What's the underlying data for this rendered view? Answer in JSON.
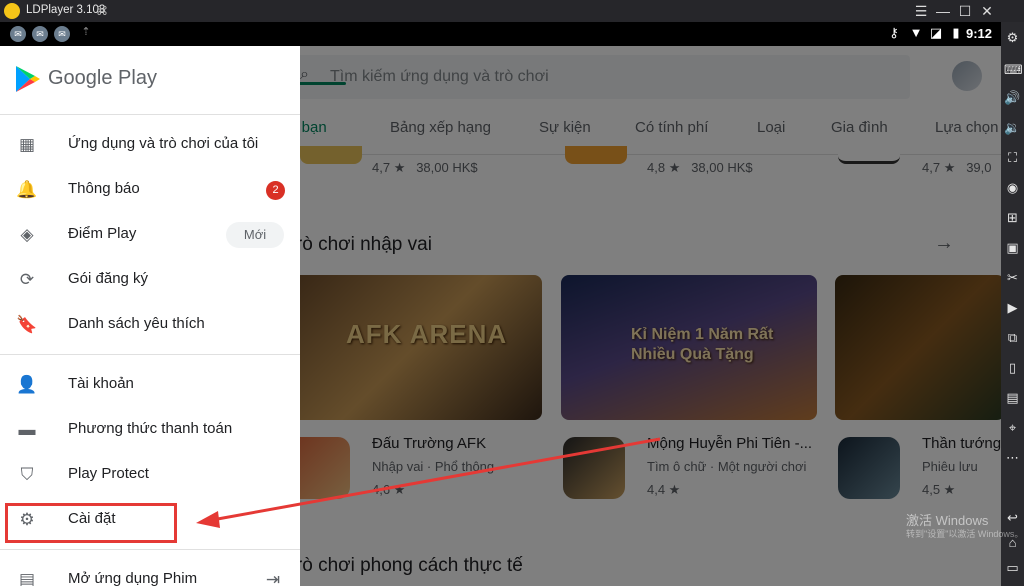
{
  "emulator": {
    "title": "LDPlayer 3.103",
    "controls": {
      "menu": "☰",
      "minimize": "—",
      "restore": "☐",
      "close": "✕"
    }
  },
  "statusbar": {
    "time": "9:12",
    "icons": [
      "key-icon",
      "wifi-icon",
      "no-sim-icon",
      "battery-icon"
    ]
  },
  "store": {
    "search_placeholder": "Tìm kiếm ứng dụng và trò chơi",
    "tabs": [
      "Cho bạn",
      "Bảng xếp hạng",
      "Sự kiện",
      "Có tính phí",
      "Loại",
      "Gia đình",
      "Lựa chọn"
    ],
    "top_row": [
      {
        "rating": "4,7",
        "price": "38,00 HK$"
      },
      {
        "rating": "4,8",
        "price": "38,00 HK$"
      },
      {
        "rating": "4,7",
        "price": "39,0"
      }
    ],
    "section1": "Trò chơi nhập vai",
    "section2": "Trò chơi phong cách thực tế",
    "banners": [
      {
        "text": "AFK ARENA"
      },
      {
        "text": "Kỉ Niệm 1 Năm Rất Nhiều Quà Tặng"
      },
      {
        "text": ""
      }
    ],
    "apps": [
      {
        "name": "Đấu Trường AFK",
        "category": "Nhập vai · Phổ thông",
        "rating": "4,6 ★"
      },
      {
        "name": "Mộng Huyễn Phi Tiên -...",
        "category": "Tìm ô chữ · Một người chơi",
        "rating": "4,4 ★"
      },
      {
        "name": "Thần tướng",
        "category": "Phiêu lưu",
        "rating": "4,5 ★"
      }
    ]
  },
  "drawer": {
    "brand": "Google Play",
    "items_group1": [
      {
        "icon": "grid-icon",
        "label": "Ứng dụng và trò chơi của tôi"
      },
      {
        "icon": "bell-icon",
        "label": "Thông báo",
        "badge": "2"
      },
      {
        "icon": "diamond-icon",
        "label": "Điểm Play",
        "tag": "Mới"
      },
      {
        "icon": "refresh-icon",
        "label": "Gói đăng ký"
      },
      {
        "icon": "bookmark-icon",
        "label": "Danh sách yêu thích"
      }
    ],
    "items_group2": [
      {
        "icon": "person-icon",
        "label": "Tài khoản"
      },
      {
        "icon": "card-icon",
        "label": "Phương thức thanh toán"
      },
      {
        "icon": "shield-icon",
        "label": "Play Protect"
      },
      {
        "icon": "gear-icon",
        "label": "Cài đặt"
      }
    ],
    "items_group3": [
      {
        "icon": "film-icon",
        "label": "Mở ứng dụng Phim"
      }
    ]
  },
  "watermark": {
    "line1": "激活 Windows",
    "line2": "转到\"设置\"以激活 Windows。"
  },
  "colors": {
    "accent": "#01875f",
    "highlight": "#e53935",
    "badge": "#d93025"
  }
}
